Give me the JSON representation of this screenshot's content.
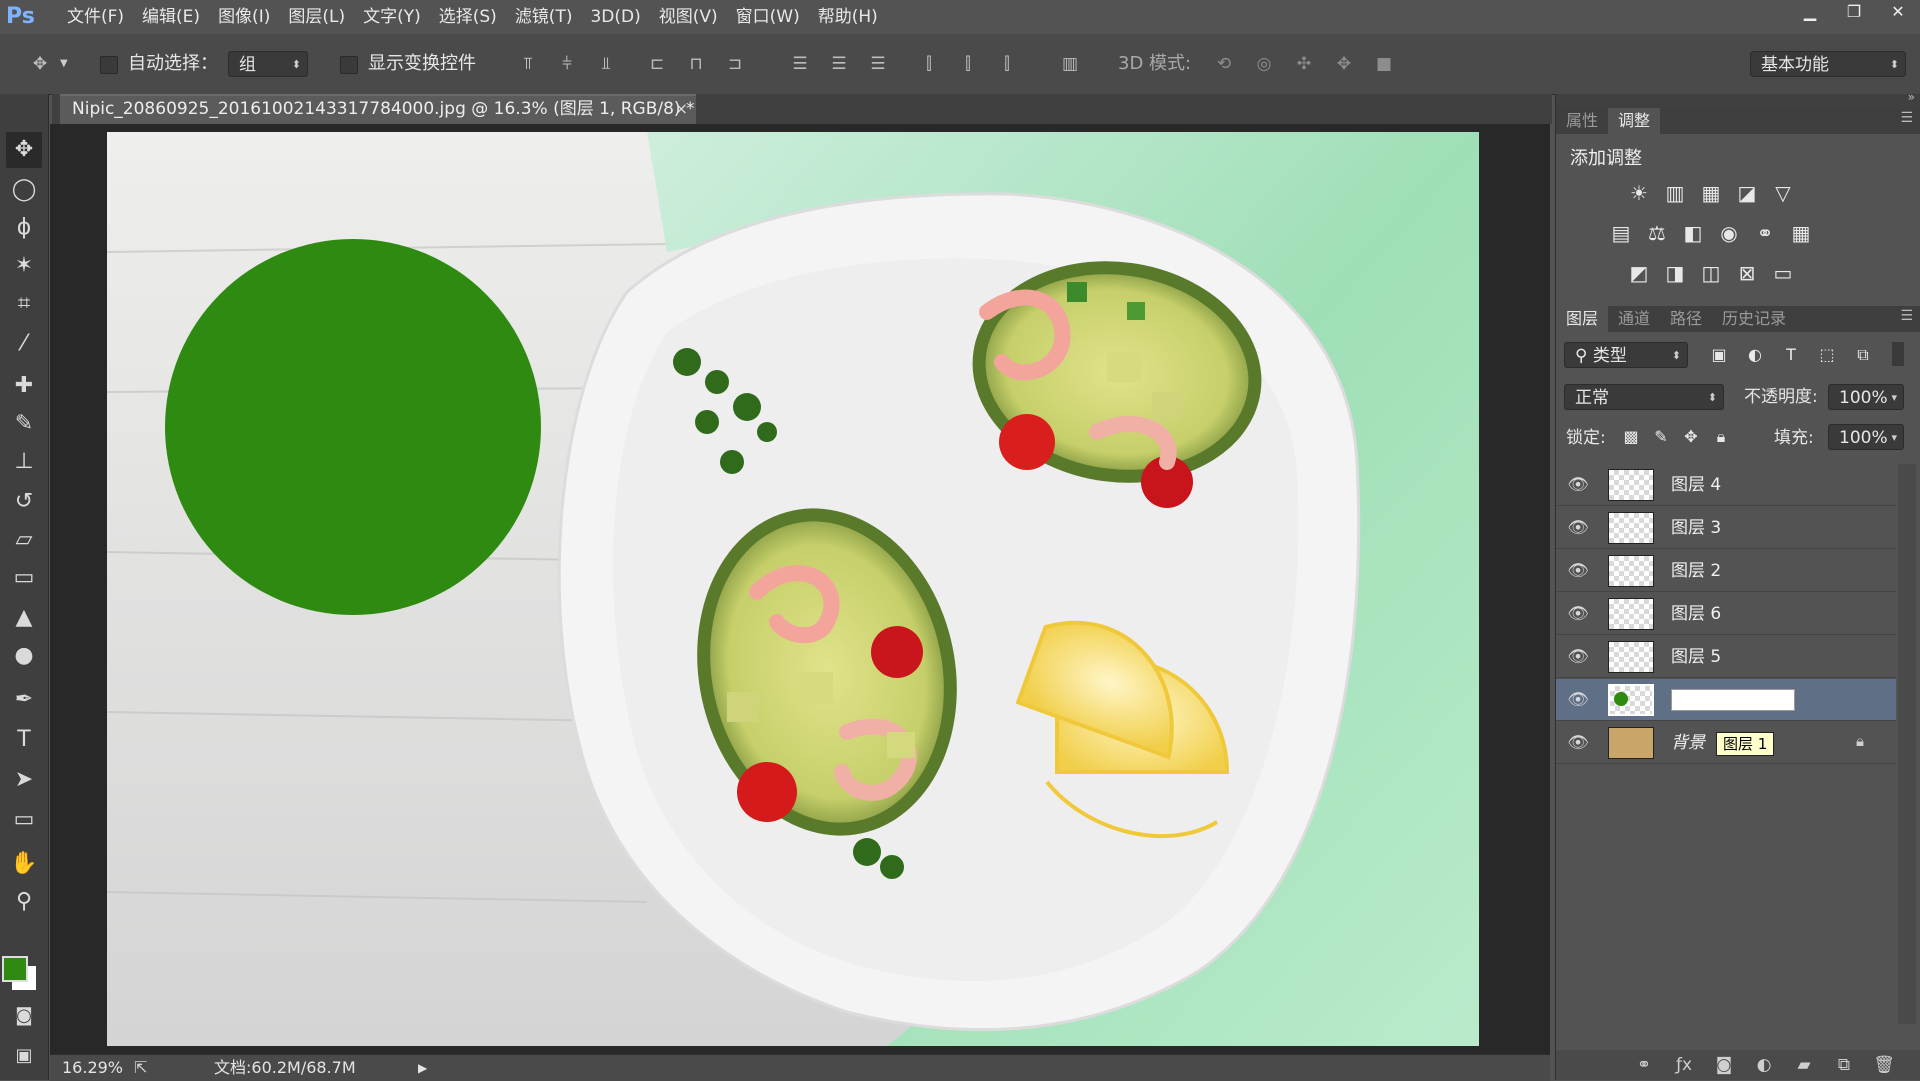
{
  "app": {
    "logo": "Ps",
    "window_controls": [
      "minimize",
      "restore",
      "close"
    ]
  },
  "menu": [
    "文件(F)",
    "编辑(E)",
    "图像(I)",
    "图层(L)",
    "文字(Y)",
    "选择(S)",
    "滤镜(T)",
    "3D(D)",
    "视图(V)",
    "窗口(W)",
    "帮助(H)"
  ],
  "options": {
    "auto_select_label": "自动选择：",
    "auto_select_value": "组",
    "show_transform_label": "显示变换控件",
    "mode_3d_label": "3D 模式:",
    "workspace": "基本功能"
  },
  "document": {
    "tab_title": "Nipic_20860925_20161002143317784000.jpg @ 16.3% (图层 1, RGB/8) *",
    "zoom": "16.29%",
    "doc_size": "文档:60.2M/68.7M"
  },
  "tools": [
    "move-tool",
    "ellipse-marquee-tool",
    "lasso-tool",
    "magic-wand-tool",
    "crop-tool",
    "eyedropper-tool",
    "healing-brush-tool",
    "brush-tool",
    "clone-stamp-tool",
    "history-brush-tool",
    "eraser-tool",
    "gradient-tool",
    "blur-tool",
    "dodge-tool",
    "pen-tool",
    "type-tool",
    "path-selection-tool",
    "rectangle-tool",
    "hand-tool",
    "zoom-tool"
  ],
  "colors": {
    "foreground": "#2e8a10",
    "background": "#ffffff",
    "circle": "#2e8a10",
    "selected_layer": "#5e6f86"
  },
  "panels": {
    "top_tabs": [
      "属性",
      "调整"
    ],
    "adjust_title": "添加调整",
    "layer_tabs": [
      "图层",
      "通道",
      "路径",
      "历史记录"
    ],
    "filter_kind": "类型",
    "blend_mode": "正常",
    "opacity_label": "不透明度:",
    "opacity_value": "100%",
    "lock_label": "锁定:",
    "fill_label": "填充:",
    "fill_value": "100%"
  },
  "layers": [
    {
      "name": "图层 4"
    },
    {
      "name": "图层 3"
    },
    {
      "name": "图层 2"
    },
    {
      "name": "图层 6"
    },
    {
      "name": "图层 5"
    },
    {
      "name": ""
    },
    {
      "name": "背景",
      "rename_hint": "图层 1"
    }
  ]
}
